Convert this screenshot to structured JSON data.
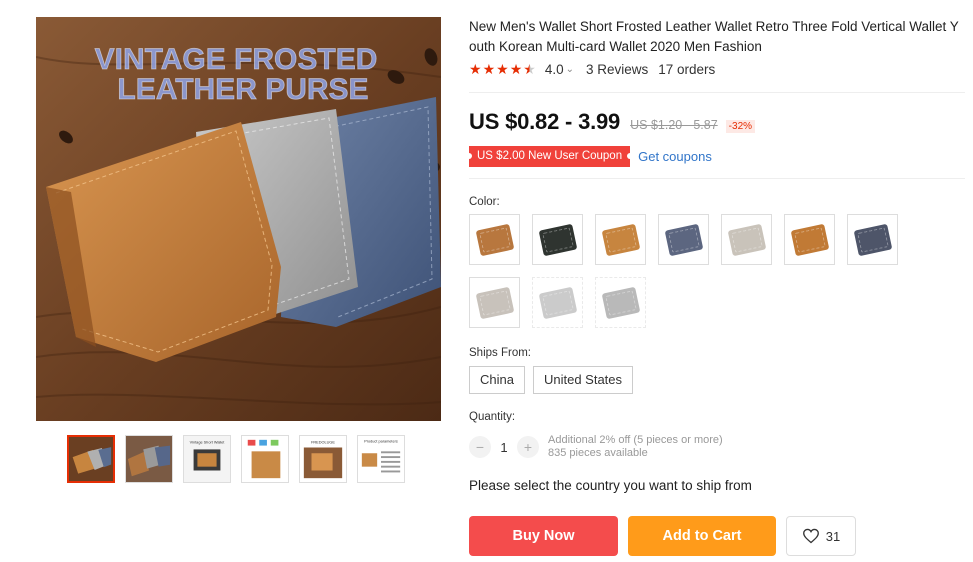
{
  "gallery": {
    "overlay_line1": "VINTAGE FROSTED",
    "overlay_line2": "LEATHER PURSE",
    "thumb_titles": [
      "Vintage Short Wallet",
      "FREDOLUGE",
      "Product parameters"
    ]
  },
  "product": {
    "title": "New Men's Wallet Short Frosted Leather Wallet Retro Three Fold Vertical Wallet Youth Korean Multi-card Wallet 2020 Men Fashion",
    "rating": "4.0",
    "reviews": "3 Reviews",
    "orders": "17 orders",
    "stars": 4,
    "price": "US $0.82 - 3.99",
    "old_price": "US $1.20 - 5.87",
    "discount": "-32%",
    "coupon": "US $2.00 New User Coupon",
    "get_coupons": "Get coupons"
  },
  "colors_section": {
    "label": "Color:",
    "swatches": [
      {
        "color": "#b8773e",
        "available": true
      },
      {
        "color": "#2f3430",
        "available": true
      },
      {
        "color": "#c7853f",
        "available": true
      },
      {
        "color": "#5c6680",
        "available": true
      },
      {
        "color": "#c9c3ba",
        "available": true
      },
      {
        "color": "#c17a35",
        "available": true
      },
      {
        "color": "#4e5569",
        "available": true
      },
      {
        "color": "#c8c2bb",
        "available": true
      },
      {
        "color": "#a9a9a9",
        "available": false
      },
      {
        "color": "#8c8c8c",
        "available": false
      }
    ]
  },
  "shipping": {
    "label": "Ships From:",
    "options": [
      "China",
      "United States"
    ],
    "note": "Please select the country you want to ship from"
  },
  "quantity": {
    "label": "Quantity:",
    "value": "1",
    "minus": "−",
    "plus": "+",
    "info_line1": "Additional 2% off (5 pieces or more)",
    "info_line2": "835 pieces available"
  },
  "actions": {
    "buy_now": "Buy Now",
    "add_to_cart": "Add to Cart",
    "wishlist_count": "31"
  },
  "colors": {
    "accent_red": "#f44c4c",
    "accent_orange": "#ff9b1a",
    "star": "#e62e04",
    "link": "#3175c9"
  }
}
